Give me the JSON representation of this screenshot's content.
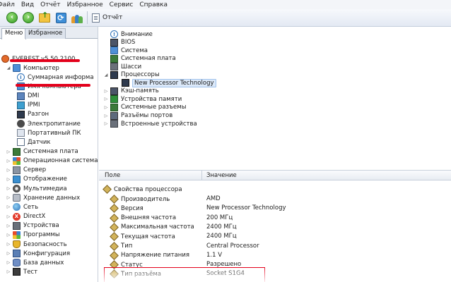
{
  "menu": [
    "Файл",
    "Вид",
    "Отчёт",
    "Избранное",
    "Сервис",
    "Справка"
  ],
  "toolbar": {
    "report_label": "Отчёт"
  },
  "tabs": {
    "menu": "Меню",
    "favorites": "Избранное"
  },
  "left_tree": [
    {
      "label": "EVEREST v5.50.2100",
      "icon": "everest-icon",
      "indent": 0,
      "arrow": ""
    },
    {
      "label": "Компьютер",
      "icon": "monitor-icon",
      "indent": 1,
      "arrow": "open"
    },
    {
      "label": "Суммарная информа",
      "icon": "info-icon",
      "indent": 2,
      "arrow": ""
    },
    {
      "label": "Имя компьютера",
      "icon": "monitor-icon",
      "indent": 2,
      "arrow": ""
    },
    {
      "label": "DMI",
      "icon": "dmi-icon",
      "indent": 2,
      "arrow": ""
    },
    {
      "label": "IPMI",
      "icon": "ipmi-icon",
      "indent": 2,
      "arrow": ""
    },
    {
      "label": "Разгон",
      "icon": "cpu-icon",
      "indent": 2,
      "arrow": ""
    },
    {
      "label": "Электропитание",
      "icon": "power-icon",
      "indent": 2,
      "arrow": ""
    },
    {
      "label": "Портативный ПК",
      "icon": "laptop-icon",
      "indent": 2,
      "arrow": ""
    },
    {
      "label": "Датчик",
      "icon": "sensor-icon",
      "indent": 2,
      "arrow": ""
    },
    {
      "label": "Системная плата",
      "icon": "motherboard-icon",
      "indent": 1,
      "arrow": "closed"
    },
    {
      "label": "Операционная система",
      "icon": "windows-icon",
      "indent": 1,
      "arrow": "closed"
    },
    {
      "label": "Сервер",
      "icon": "server-icon",
      "indent": 1,
      "arrow": "closed"
    },
    {
      "label": "Отображение",
      "icon": "display-icon",
      "indent": 1,
      "arrow": "closed"
    },
    {
      "label": "Мультимедиа",
      "icon": "multimedia-icon",
      "indent": 1,
      "arrow": "closed"
    },
    {
      "label": "Хранение данных",
      "icon": "storage-icon",
      "indent": 1,
      "arrow": "closed"
    },
    {
      "label": "Сеть",
      "icon": "network-icon",
      "indent": 1,
      "arrow": "closed"
    },
    {
      "label": "DirectX",
      "icon": "directx-icon",
      "indent": 1,
      "arrow": "closed"
    },
    {
      "label": "Устройства",
      "icon": "devices-icon",
      "indent": 1,
      "arrow": "closed"
    },
    {
      "label": "Программы",
      "icon": "programs-icon",
      "indent": 1,
      "arrow": "closed"
    },
    {
      "label": "Безопасность",
      "icon": "security-icon",
      "indent": 1,
      "arrow": "closed"
    },
    {
      "label": "Конфигурация",
      "icon": "config-icon",
      "indent": 1,
      "arrow": "closed"
    },
    {
      "label": "База данных",
      "icon": "database-icon",
      "indent": 1,
      "arrow": "closed"
    },
    {
      "label": "Тест",
      "icon": "test-icon",
      "indent": 1,
      "arrow": "closed"
    }
  ],
  "right_tree": [
    {
      "label": "Внимание",
      "indent": 0,
      "arrow": ""
    },
    {
      "label": "BIOS",
      "indent": 0,
      "arrow": ""
    },
    {
      "label": "Система",
      "indent": 0,
      "arrow": ""
    },
    {
      "label": "Системная плата",
      "indent": 0,
      "arrow": ""
    },
    {
      "label": "Шасси",
      "indent": 0,
      "arrow": ""
    },
    {
      "label": "Процессоры",
      "indent": 0,
      "arrow": "open"
    },
    {
      "label": "New Processor Technology",
      "indent": 1,
      "arrow": "",
      "selected": true
    },
    {
      "label": "Кэш-память",
      "indent": 0,
      "arrow": "closed"
    },
    {
      "label": "Устройства памяти",
      "indent": 0,
      "arrow": "closed"
    },
    {
      "label": "Системные разъемы",
      "indent": 0,
      "arrow": "closed"
    },
    {
      "label": "Разъёмы портов",
      "indent": 0,
      "arrow": "closed"
    },
    {
      "label": "Встроенные устройства",
      "indent": 0,
      "arrow": "closed"
    }
  ],
  "table": {
    "col_field": "Поле",
    "col_value": "Значение",
    "group": "Свойства процессора",
    "rows": [
      {
        "field": "Производитель",
        "value": "AMD"
      },
      {
        "field": "Версия",
        "value": "New Processor Technology"
      },
      {
        "field": "Внешняя частота",
        "value": "200 МГц"
      },
      {
        "field": "Максимальная частота",
        "value": "2400 МГц"
      },
      {
        "field": "Текущая частота",
        "value": "2400 МГц"
      },
      {
        "field": "Тип",
        "value": "Central Processor"
      },
      {
        "field": "Напряжение питания",
        "value": "1.1 V"
      },
      {
        "field": "Статус",
        "value": "Разрешено"
      },
      {
        "field": "Тип разъёма",
        "value": "Socket S1G4"
      }
    ]
  }
}
